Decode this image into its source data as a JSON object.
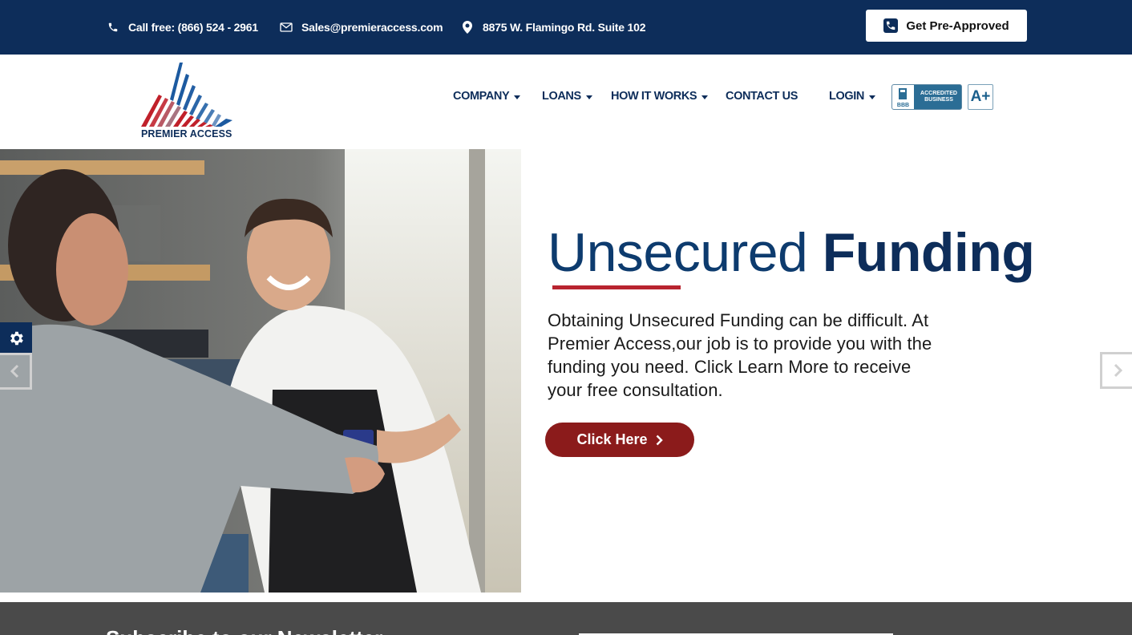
{
  "topbar": {
    "call_label": "Call free:",
    "phone": "(866) 524 - 2961",
    "email": "Sales@premieraccess.com",
    "address": "8875 W. Flamingo Rd. Suite 102",
    "preapproved_label": "Get Pre-Approved"
  },
  "logo": {
    "text": "PREMIER ACCESS"
  },
  "nav": {
    "items": [
      {
        "label": "COMPANY",
        "dropdown": true
      },
      {
        "label": "LOANS",
        "dropdown": true
      },
      {
        "label": "HOW IT WORKS",
        "dropdown": true
      },
      {
        "label": "CONTACT US",
        "dropdown": false
      },
      {
        "label": "LOGIN",
        "dropdown": true
      }
    ],
    "bbb_text": "ACCREDITED BUSINESS",
    "bbb_small": "BBB",
    "rating": "A+"
  },
  "hero": {
    "title_light": "Unsecured",
    "title_bold": "Funding",
    "description": "Obtaining Unsecured Funding can be difficult. At Premier Access,our job is to provide you with the funding you need. Click Learn More to receive your free consultation.",
    "cta_label": "Click Here"
  },
  "footer_band": {
    "heading": "Subscribe to our Newsletter"
  },
  "colors": {
    "navy": "#0d2d5a",
    "accent_red": "#b8242f",
    "cta_red": "#8b1b1b",
    "band_gray": "#4a4a4a"
  },
  "icons": [
    "phone-icon",
    "mail-icon",
    "map-pin-icon",
    "phone-square-icon",
    "chevron-right-icon",
    "gear-icon",
    "chevron-left-icon"
  ]
}
